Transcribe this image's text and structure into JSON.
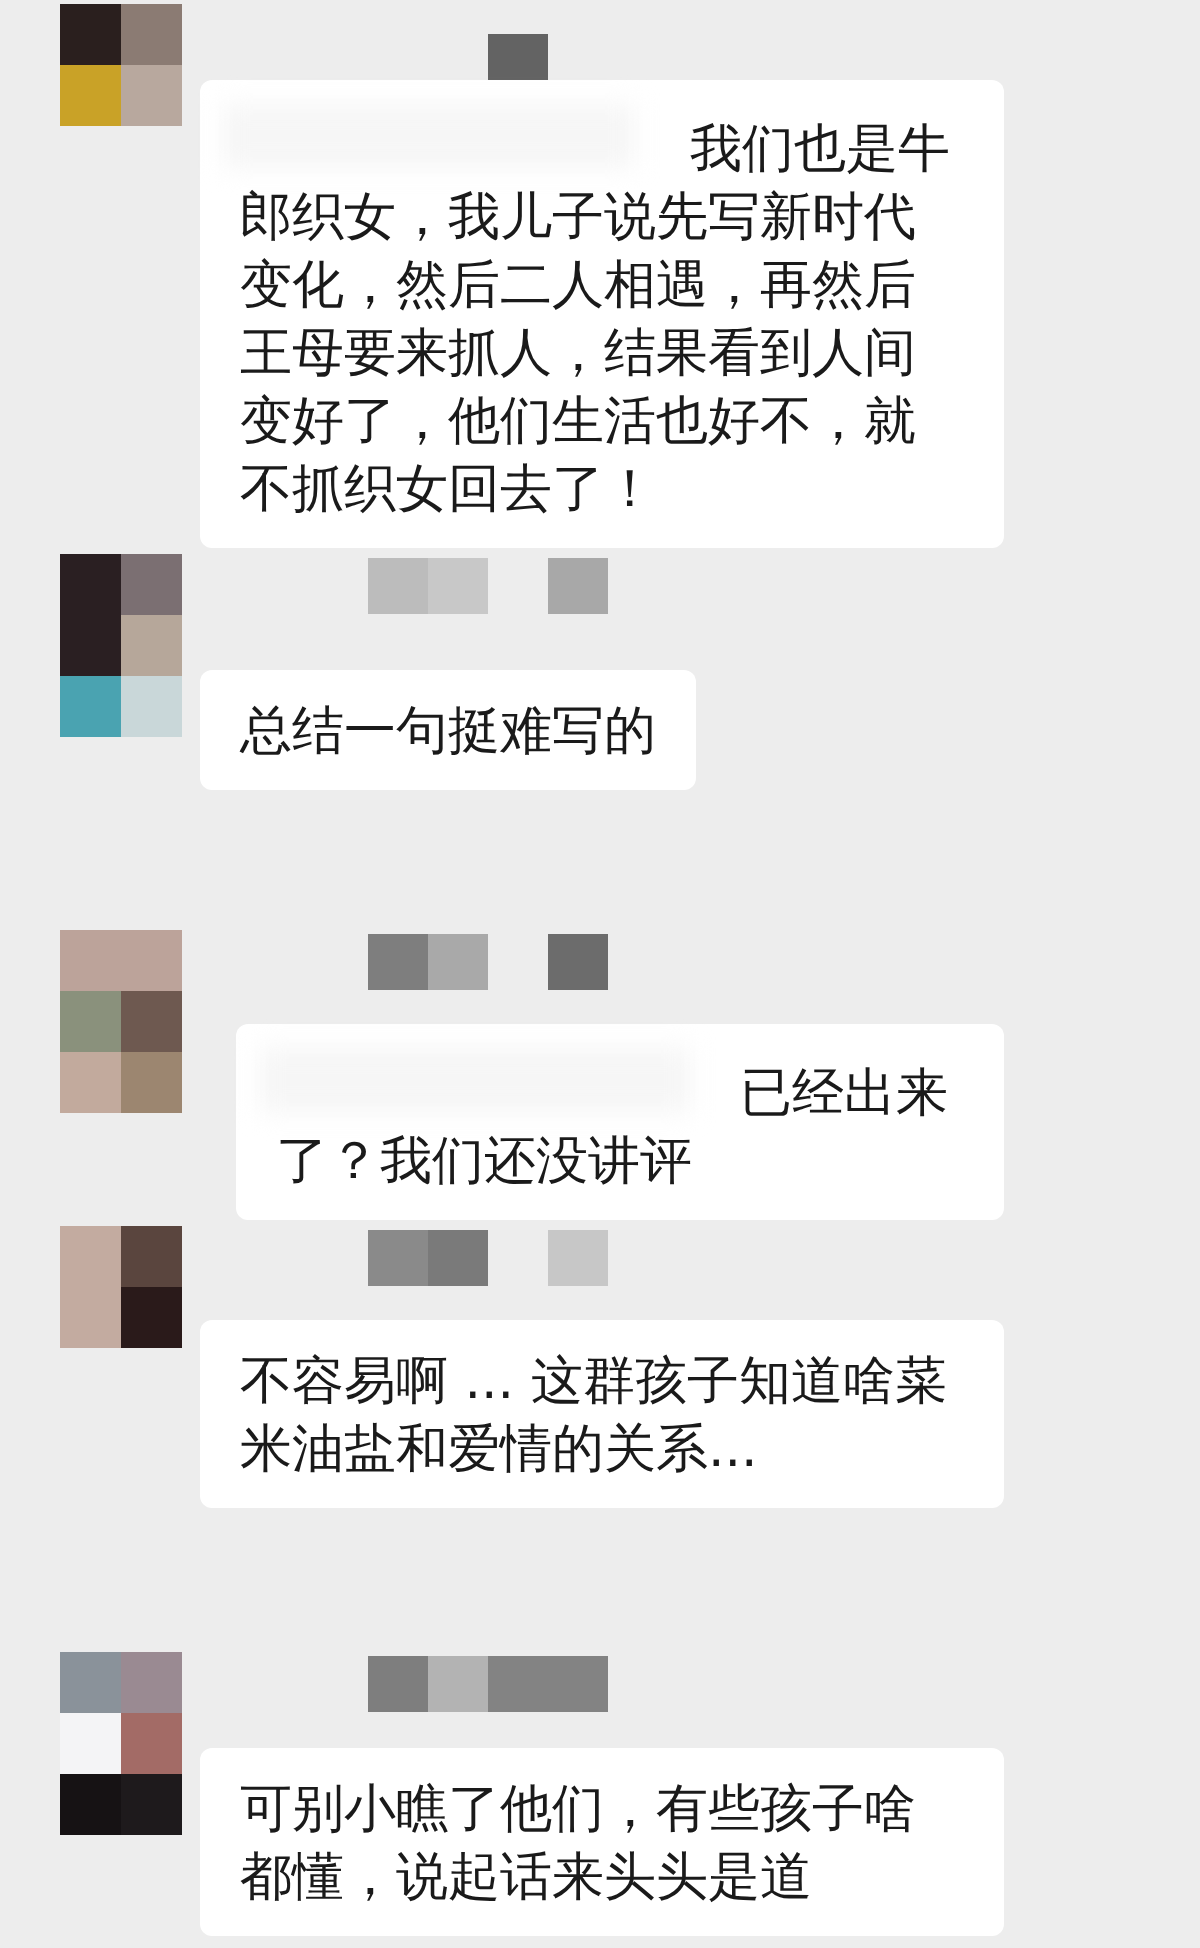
{
  "messages": [
    {
      "obscured": true,
      "text": "我们也是牛郎织女，我儿子说先写新时代变化，然后二人相遇，再然后王母要来抓人，结果看到人间变好了，他们生活也好不，就不抓织女回去了！"
    },
    {
      "obscured": false,
      "text": "总结一句挺难写的"
    },
    {
      "obscured": true,
      "text": "已经出来了？我们还没讲评"
    },
    {
      "obscured": false,
      "text": "不容易啊 ... 这群孩子知道啥菜米油盐和爱情的关系..."
    },
    {
      "obscured": false,
      "text": "可别小瞧了他们，有些孩子啥都懂，说起话来头头是道"
    }
  ]
}
